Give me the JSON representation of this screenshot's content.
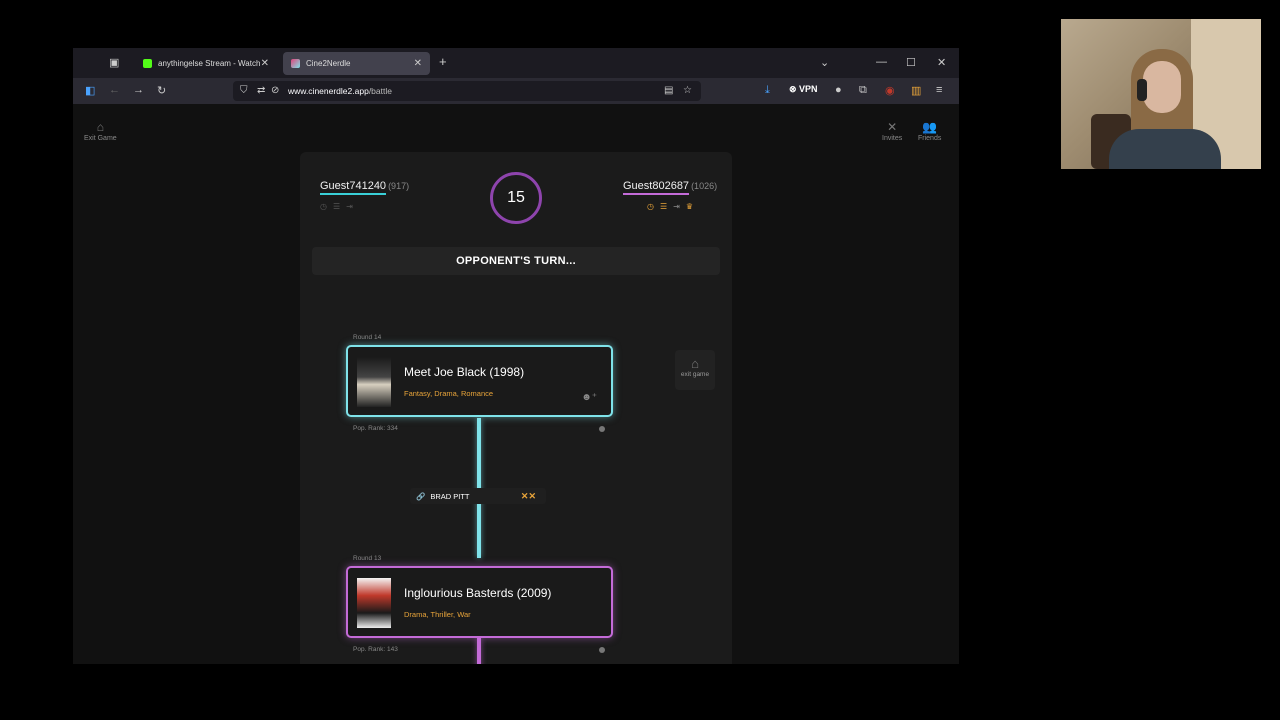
{
  "browser": {
    "tabs": [
      {
        "title": "anythingelse Stream - Watch Li",
        "favicon_color": "#53fc18"
      },
      {
        "title": "Cine2Nerdle",
        "favicon_color": "#e0457b"
      }
    ],
    "url_domain": "www.cinenerdle2.app",
    "url_path": "/battle",
    "vpn_label": "VPN"
  },
  "page": {
    "exit_game_label": "Exit Game",
    "invites_label": "Invites",
    "friends_label": "Friends"
  },
  "game": {
    "player1": {
      "name": "Guest741240",
      "elo": "(917)",
      "underline": "#3ad0d8"
    },
    "player2": {
      "name": "Guest802687",
      "elo": "(1026)",
      "underline": "#c46bd8"
    },
    "timer": "15",
    "turn_text": "OPPONENT'S TURN...",
    "side_exit_label": "exit game",
    "rounds": [
      {
        "round_label": "Round 14",
        "title": "Meet Joe Black (1998)",
        "genres": "Fantasy, Drama, Romance",
        "pop_rank": "Pop. Rank: 334"
      },
      {
        "round_label": "Round 13",
        "title": "Inglourious Basterds (2009)",
        "genres": "Drama, Thriller, War",
        "pop_rank": "Pop. Rank: 143"
      }
    ],
    "connection": {
      "name": "BRAD PITT",
      "marks": "✕✕"
    }
  }
}
